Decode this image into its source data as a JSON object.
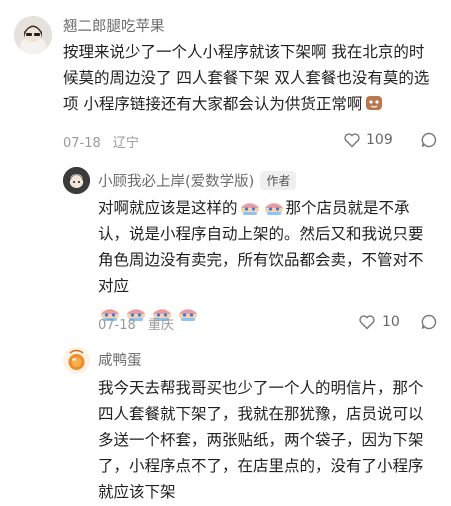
{
  "comments": [
    {
      "name": "翘二郎腿吃苹果",
      "text": "按理来说少了一个人小程序就该下架啊 我在北京的时候莫的周边没了 四人套餐下架 双人套餐也没有莫的选项 小程序链接还有大家都会认为供货正常啊",
      "date": "07-18",
      "location": "辽宁",
      "likes": "109"
    },
    {
      "name": "小顾我必上岸(爱数学版)",
      "badge": "作者",
      "text_part1": "对啊就应该是这样的",
      "text_part2": "那个店员就是不承认，说是小程序自动上架的。然后又和我说只要角色周边没有卖完，所有饮品都会卖，不管对不对应",
      "date": "07-18",
      "location": "重庆",
      "likes": "10"
    },
    {
      "name": "咸鸭蛋",
      "text": "我今天去帮我哥买也少了一个人的明信片，那个四人套餐就下架了，我就在那犹豫，店员说可以多送一个杯套，两张贴纸，两个袋子，因为下架了，小程序点不了，在店里点的，没有了小程序就应该下架"
    }
  ]
}
